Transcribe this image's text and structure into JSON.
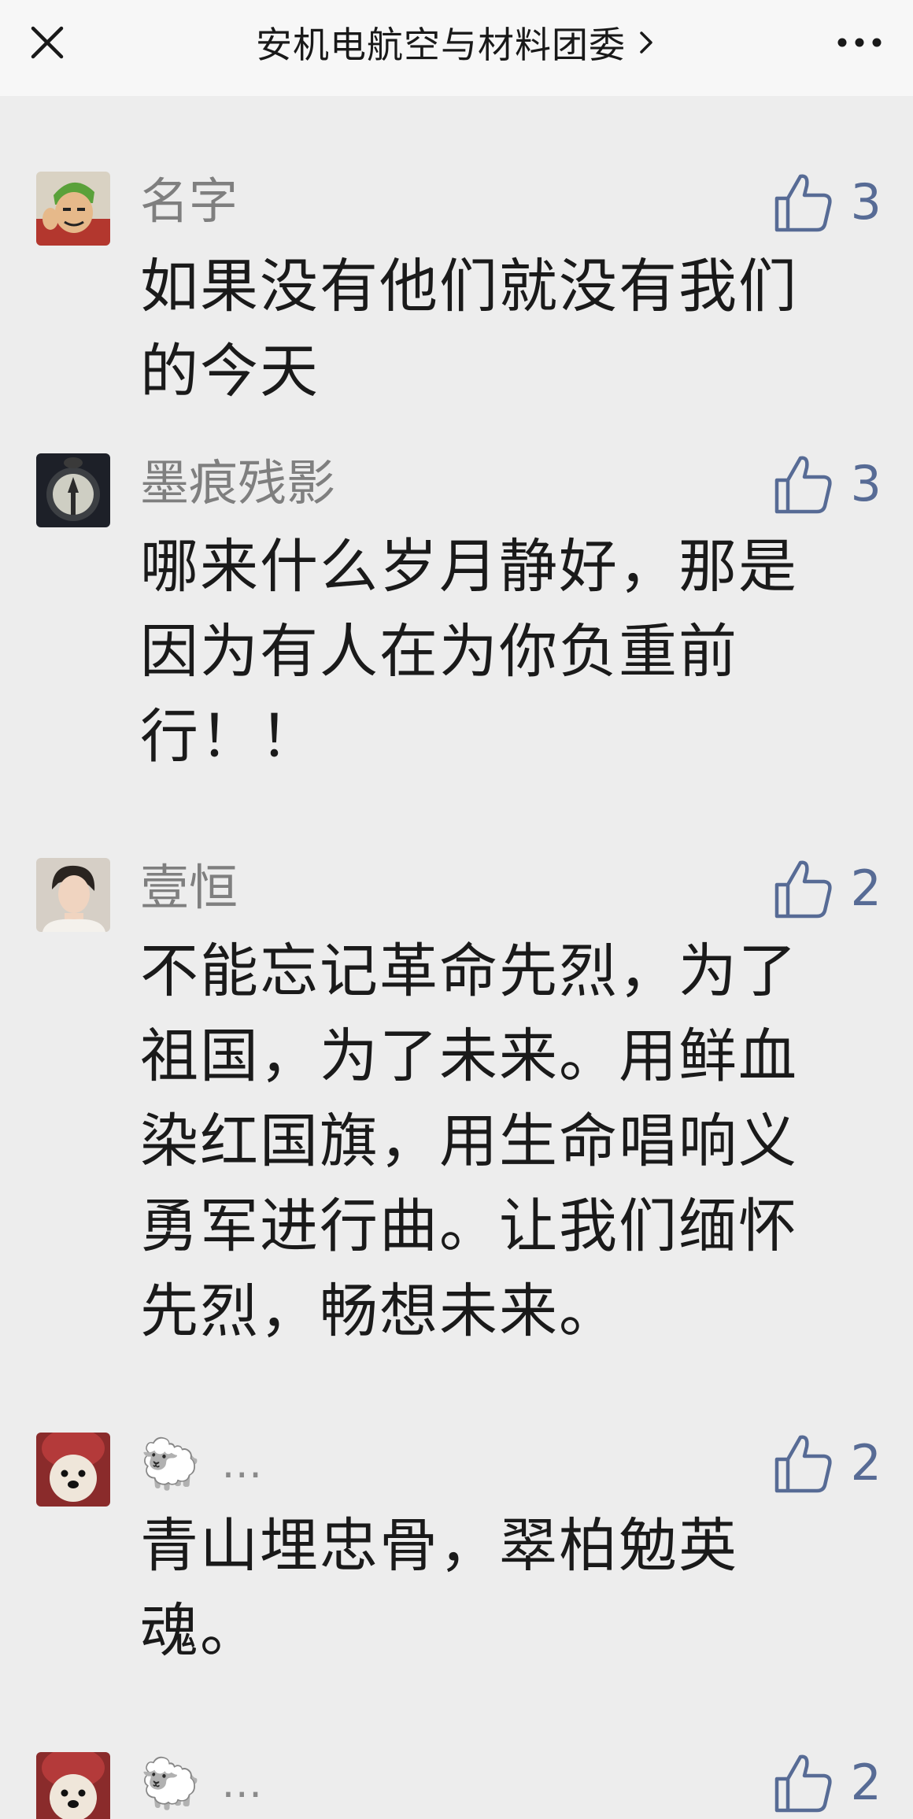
{
  "header": {
    "title": "安机电航空与材料团委",
    "close_icon": "close-icon",
    "chevron_icon": "chevron-right-icon",
    "more_icon": "more-dots-icon"
  },
  "colors": {
    "link_blue": "#576b95",
    "name_gray": "#7f7f7f",
    "background": "#ededed"
  },
  "comments": [
    {
      "name": "名字",
      "likes": "3",
      "text": "如果没有他们就没有我们的今天",
      "avatar": "cartoon-avatar"
    },
    {
      "name": "墨痕残影",
      "likes": "3",
      "text": "哪来什么岁月静好，那是因为有人在为你负重前行！！",
      "avatar": "moon-avatar"
    },
    {
      "name": "壹恒",
      "likes": "2",
      "text": "不能忘记革命先烈，为了祖国，为了未来。用鲜血染红国旗，用生命唱响义勇军进行曲。让我们缅怀先烈，畅想未来。",
      "avatar": "person-avatar"
    },
    {
      "name_emoji": "🐑",
      "name_suffix": "…",
      "likes": "2",
      "text": "青山埋忠骨，翠柏勉英魂。",
      "avatar": "dog-avatar"
    },
    {
      "name_emoji": "🐑",
      "name_suffix": "…",
      "likes": "2",
      "text": "",
      "avatar": "dog-avatar"
    }
  ]
}
